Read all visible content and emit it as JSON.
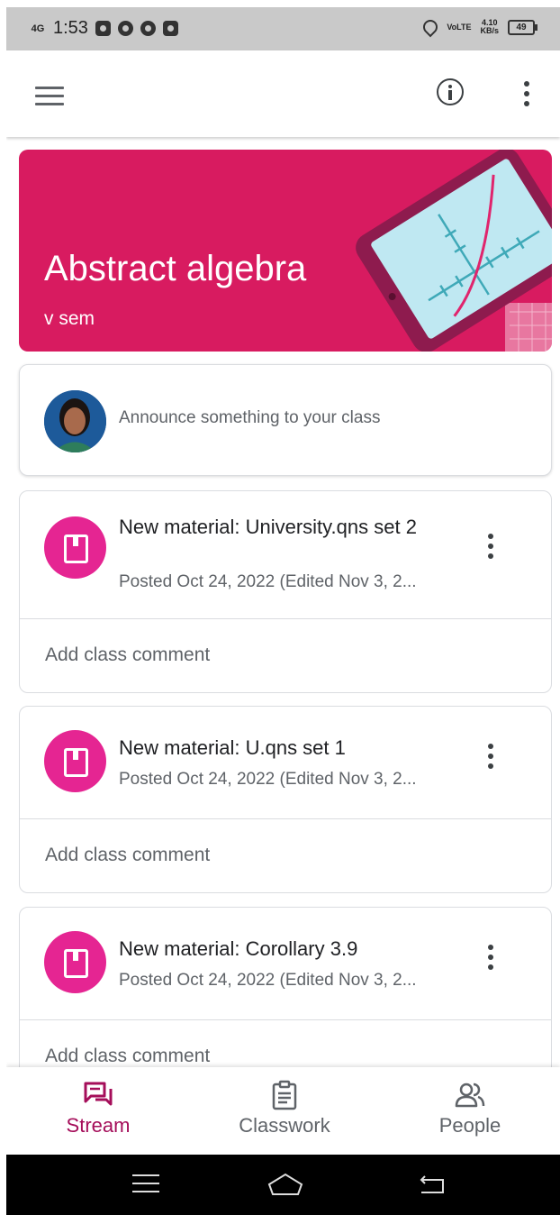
{
  "status_bar": {
    "network": "4G",
    "time": "1:53",
    "lte": "VoLTE",
    "speed_value": "4.10",
    "speed_unit": "KB/s",
    "battery": "49"
  },
  "class": {
    "title": "Abstract algebra",
    "section": "v sem"
  },
  "announce": {
    "placeholder": "Announce something to your class"
  },
  "posts": [
    {
      "title": "New material: University.qns set 2",
      "meta": "Posted Oct 24, 2022 (Edited Nov 3, 2...",
      "comment_label": "Add class comment"
    },
    {
      "title": "New material: U.qns set 1",
      "meta": "Posted Oct 24, 2022 (Edited Nov 3, 2...",
      "comment_label": "Add class comment"
    },
    {
      "title": "New material: Corollary 3.9",
      "meta": "Posted Oct 24, 2022 (Edited Nov 3, 2...",
      "comment_label": "Add class comment"
    }
  ],
  "bottom_nav": [
    {
      "label": "Stream",
      "icon": "stream-icon",
      "active": true
    },
    {
      "label": "Classwork",
      "icon": "classwork-icon",
      "active": false
    },
    {
      "label": "People",
      "icon": "people-icon",
      "active": false
    }
  ],
  "colors": {
    "banner": "#d81b60",
    "material_icon": "#e52592",
    "active_nav": "#a50e5a"
  }
}
